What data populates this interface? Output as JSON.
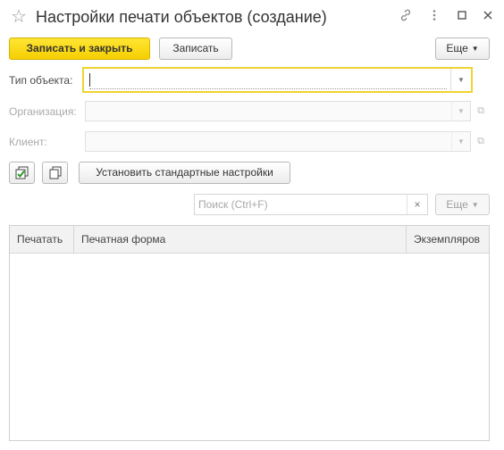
{
  "window": {
    "title": "Настройки печати объектов (создание)",
    "favorite_icon": "star-icon",
    "link_icon": "link-icon",
    "menu_icon": "more-vert-icon",
    "maximize_icon": "maximize-icon",
    "close_icon": "close-icon"
  },
  "toolbar": {
    "save_close_label": "Записать и закрыть",
    "save_label": "Записать",
    "more_label": "Еще"
  },
  "form": {
    "object_type": {
      "label": "Тип объекта:",
      "value": ""
    },
    "organization": {
      "label": "Организация:",
      "value": ""
    },
    "client": {
      "label": "Клиент:",
      "value": ""
    }
  },
  "actions": {
    "check_all_icon": "check-all-icon",
    "copy_icon": "copy-icon",
    "set_default_label": "Установить стандартные настройки"
  },
  "search": {
    "placeholder": "Поиск (Ctrl+F)",
    "clear_icon": "clear-icon",
    "more_label": "Еще"
  },
  "table": {
    "columns": [
      "Печатать",
      "Печатная форма",
      "Экземпляров"
    ],
    "rows": []
  },
  "colors": {
    "primary_button": "#f5cf00",
    "focus_border": "#f0d232"
  }
}
